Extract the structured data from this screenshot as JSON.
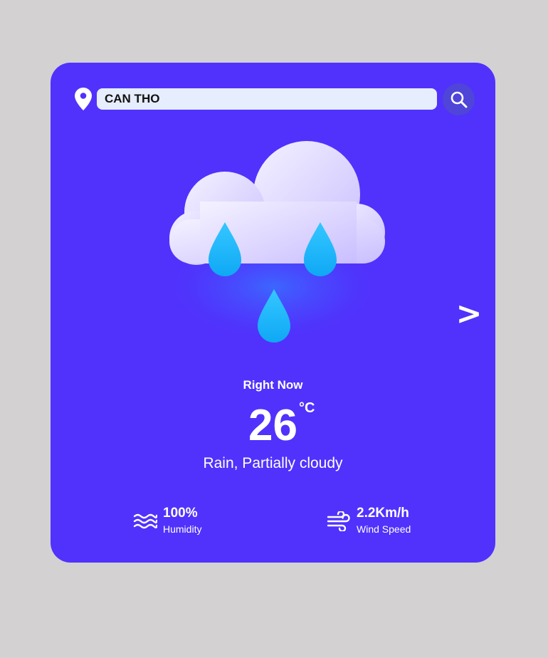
{
  "search": {
    "value": "CAN THO",
    "location_icon": "map-pin-icon",
    "button_icon": "search-icon"
  },
  "navigation": {
    "next_label": ">"
  },
  "current": {
    "heading": "Right Now",
    "temperature": "26",
    "unit": "°C",
    "condition": "Rain, Partially cloudy",
    "illustration": "rain-cloud-icon"
  },
  "stats": {
    "humidity": {
      "value": "100%",
      "label": "Humidity",
      "icon": "humidity-waves-icon"
    },
    "wind": {
      "value": "2.2Km/h",
      "label": "Wind Speed",
      "icon": "wind-icon"
    }
  },
  "colors": {
    "background": "#d3d1d2",
    "card": "#5032fc",
    "search_field": "#e6edfc",
    "search_button": "#4f45d8",
    "raindrop": "#1ab4fb"
  }
}
